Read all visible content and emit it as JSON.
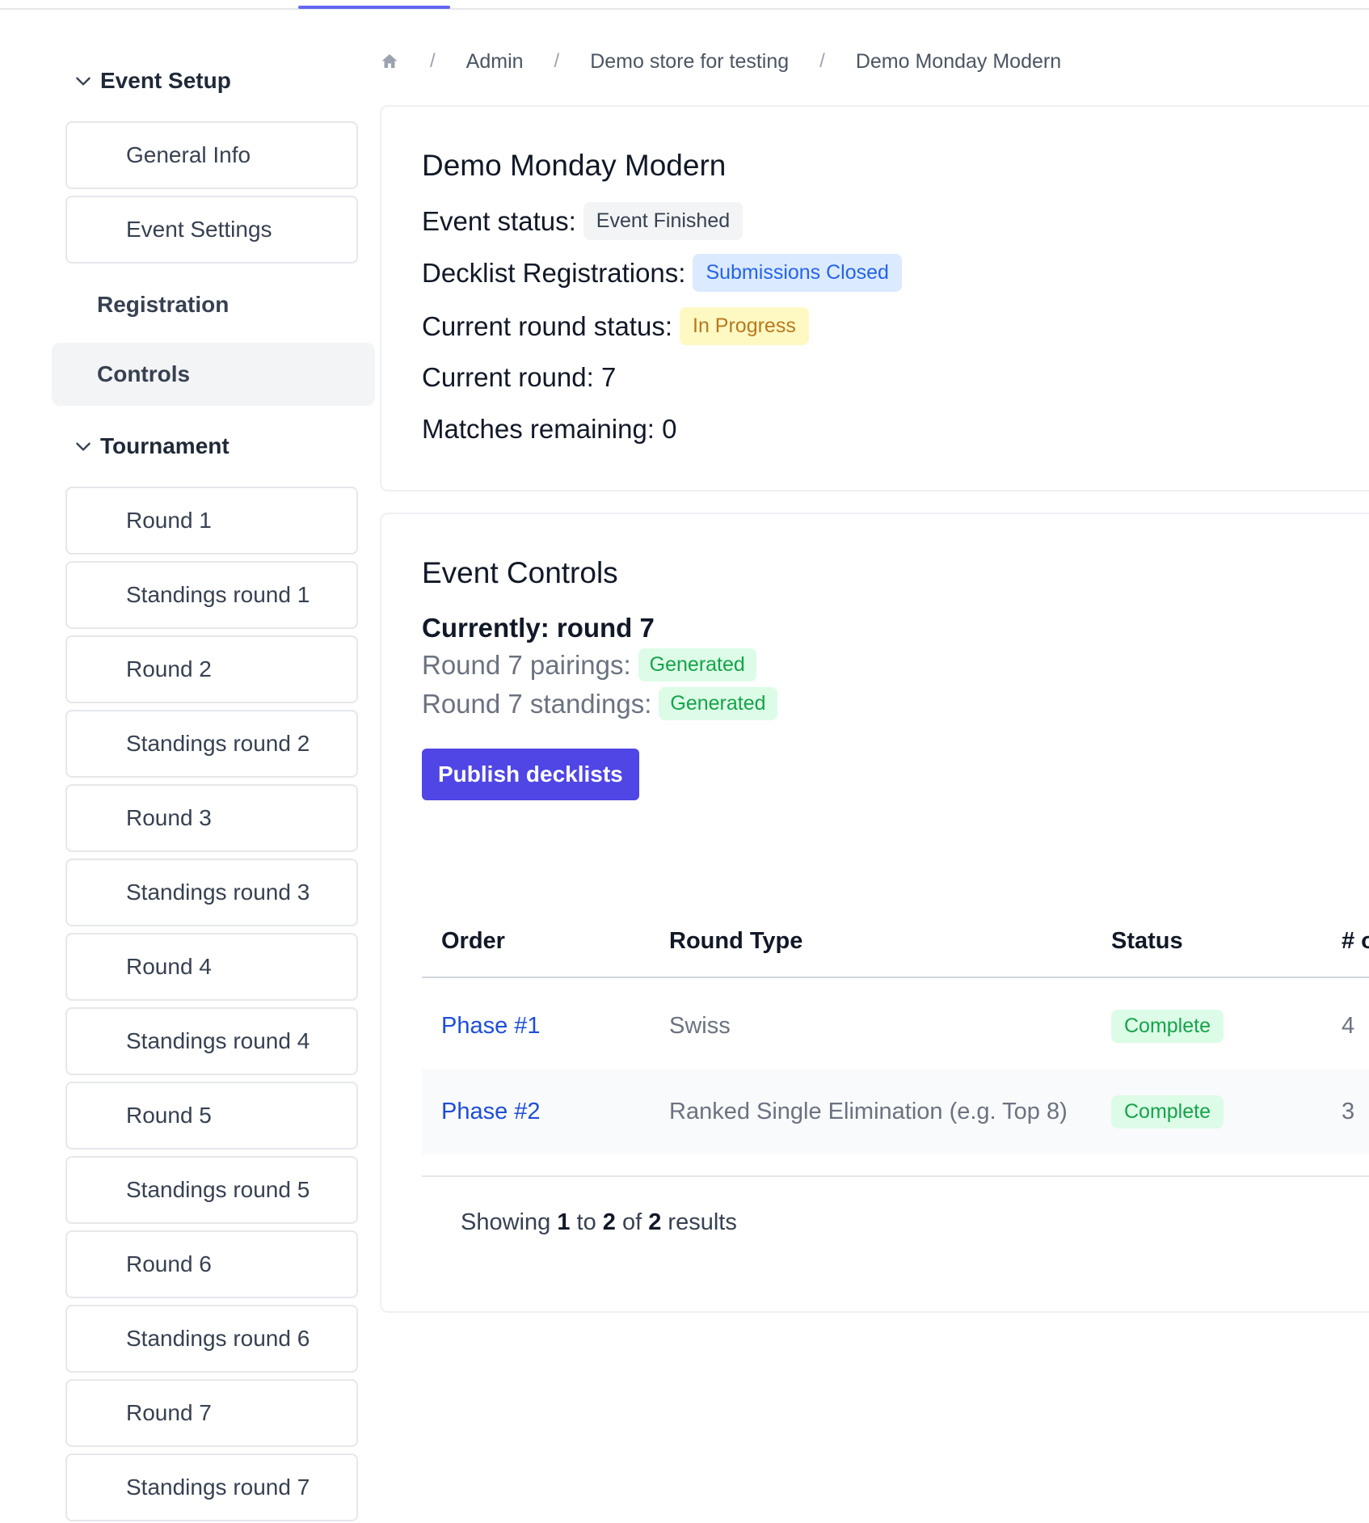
{
  "sidebar": {
    "event_setup": {
      "label": "Event Setup",
      "items": [
        "General Info",
        "Event Settings"
      ]
    },
    "registration": "Registration",
    "controls": "Controls",
    "tournament": {
      "label": "Tournament",
      "items": [
        "Round 1",
        "Standings round 1",
        "Round 2",
        "Standings round 2",
        "Round 3",
        "Standings round 3",
        "Round 4",
        "Standings round 4",
        "Round 5",
        "Standings round 5",
        "Round 6",
        "Standings round 6",
        "Round 7",
        "Standings round 7"
      ]
    }
  },
  "breadcrumb": {
    "home_icon": "home-icon",
    "items": [
      "Admin",
      "Demo store for testing",
      "Demo Monday Modern"
    ],
    "separator": "/"
  },
  "overview": {
    "title": "Demo Monday Modern",
    "event_status_label": "Event status:",
    "event_status": "Event Finished",
    "decklist_label": "Decklist Registrations:",
    "decklist_status": "Submissions Closed",
    "round_status_label": "Current round status:",
    "round_status": "In Progress",
    "current_round": "Current round: 7",
    "matches_remaining": "Matches remaining: 0"
  },
  "controls": {
    "title": "Event Controls",
    "currently": "Currently: round 7",
    "pairings_label": "Round 7 pairings:",
    "pairings_status": "Generated",
    "standings_label": "Round 7 standings:",
    "standings_status": "Generated",
    "publish_button": "Publish decklists"
  },
  "table": {
    "headers": [
      "Order",
      "Round Type",
      "Status",
      "# o"
    ],
    "rows": [
      {
        "order": "Phase #1",
        "type": "Swiss",
        "status": "Complete",
        "count": "4"
      },
      {
        "order": "Phase #2",
        "type": "Ranked Single Elimination (e.g. Top 8)",
        "status": "Complete",
        "count": "3"
      }
    ],
    "footer": {
      "prefix": "Showing",
      "from": "1",
      "to_word": "to",
      "to": "2",
      "of_word": "of",
      "total": "2",
      "suffix": "results"
    }
  },
  "colors": {
    "accent": "#4f46e5",
    "link": "#1d4ed8",
    "green_badge": "#dcfce7",
    "blue_badge": "#dbeafe",
    "yellow_badge": "#fef9c3"
  }
}
